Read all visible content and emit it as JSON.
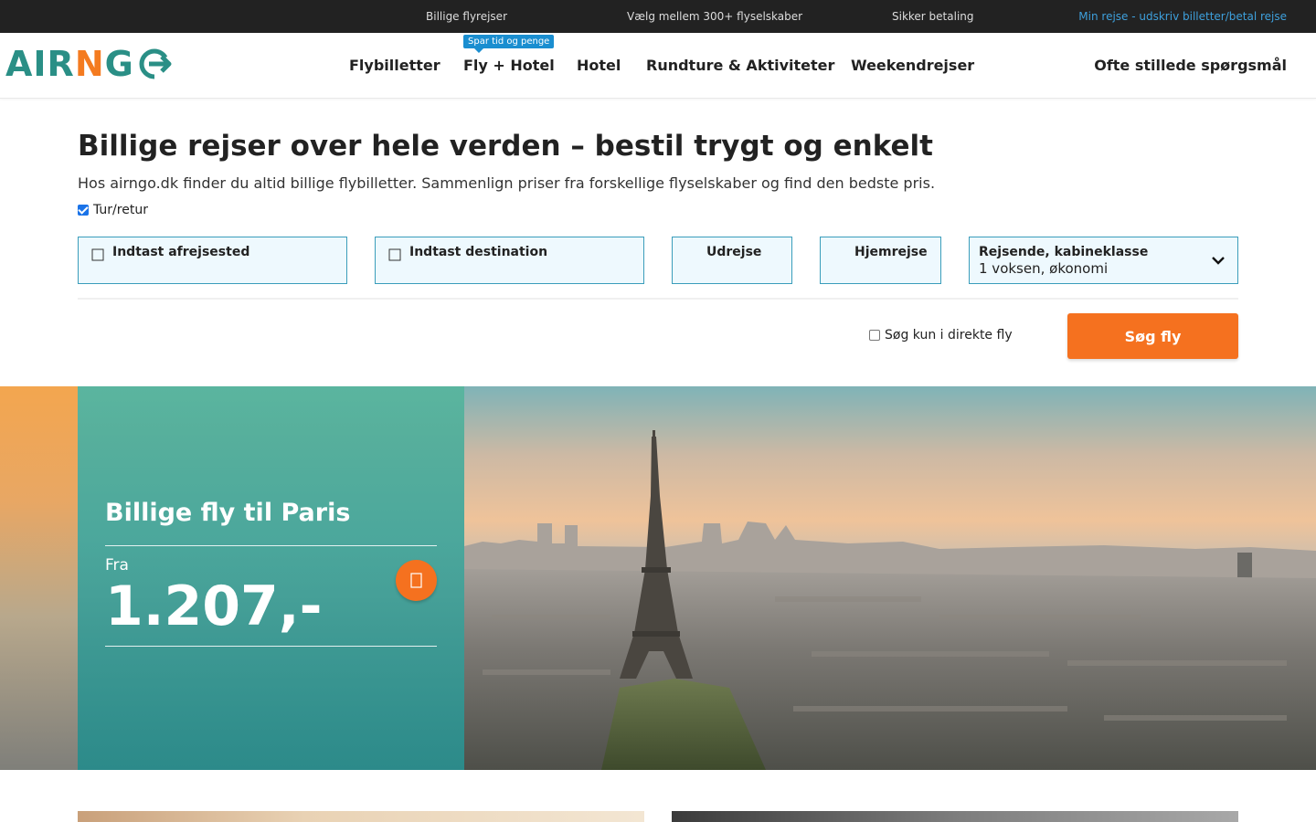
{
  "topbar": {
    "item1": "Billige flyrejser",
    "item2": "Vælg mellem 300+ flyselskaber",
    "item3": "Sikker betaling",
    "my_trip_link": "Min rejse - udskriv billetter/betal rejse"
  },
  "header": {
    "logo": {
      "part1": "AIR",
      "part2": "N",
      "part3": "G"
    },
    "nav": {
      "flights": "Flybilletter",
      "fly_hotel": "Fly + Hotel",
      "fly_hotel_badge": "Spar tid og penge",
      "hotel": "Hotel",
      "tours": "Rundture & Aktiviteter",
      "weekend": "Weekendrejser",
      "faq": "Ofte stillede spørgsmål"
    }
  },
  "search": {
    "headline": "Billige rejser over hele verden – bestil trygt og enkelt",
    "intro": "Hos airngo.dk finder du altid billige flybilletter. Sammenlign priser fra forskellige flyselskaber og find den bedste pris.",
    "round_trip_label": "Tur/retur",
    "round_trip_checked": true,
    "from_label": "Indtast afrejsested",
    "to_label": "Indtast destination",
    "depart_label": "Udrejse",
    "return_label": "Hjemrejse",
    "travelers_label": "Rejsende, kabineklasse",
    "travelers_value": "1 voksen, økonomi",
    "direct_only_label": "Søg kun i direkte fly",
    "direct_only_checked": false,
    "submit_label": "Søg fly"
  },
  "hero": {
    "title": "Billige fly til Paris",
    "from_label": "Fra",
    "price": "1.207,-"
  },
  "colors": {
    "accent_orange": "#f5711f",
    "brand_teal": "#2a8f86",
    "link_blue": "#3ea0dc",
    "badge_blue": "#1a8ed0"
  }
}
